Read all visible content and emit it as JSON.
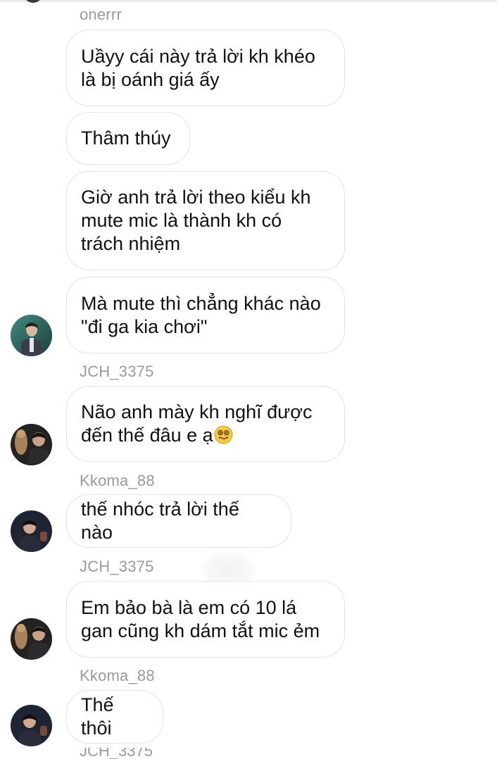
{
  "chat": {
    "messages": [
      {
        "sender": "onerrr",
        "text": "Uầyy cái này trả lời kh khéo\nlà bị oánh giá ấy"
      },
      {
        "text": "Thâm thúy"
      },
      {
        "text": "Giờ anh trả lời theo kiểu kh\nmute mic là thành kh có\ntrách nhiệm"
      },
      {
        "text": "Mà mute thì chẳng khác nào\n\"đi ga kia chơi\""
      },
      {
        "sender": "JCH_3375",
        "text": "Não anh mày kh nghĩ được\nđến thế đâu e ạ",
        "emoji": "woozy-face-icon"
      },
      {
        "sender": "Kkoma_88",
        "text": "thế nhóc trả lời thế nào"
      },
      {
        "sender": "JCH_3375",
        "text": "Em bảo bà là em có 10 lá\ngan cũng kh dám tắt mic ẻm"
      },
      {
        "sender": "Kkoma_88",
        "text": "Thế thôi"
      },
      {
        "sender": "JCH_3375"
      }
    ]
  },
  "colors": {
    "bubble_border": "#e3e3e3",
    "sender_name": "#9a9a9a",
    "message_text": "#111111",
    "background": "#ffffff"
  }
}
